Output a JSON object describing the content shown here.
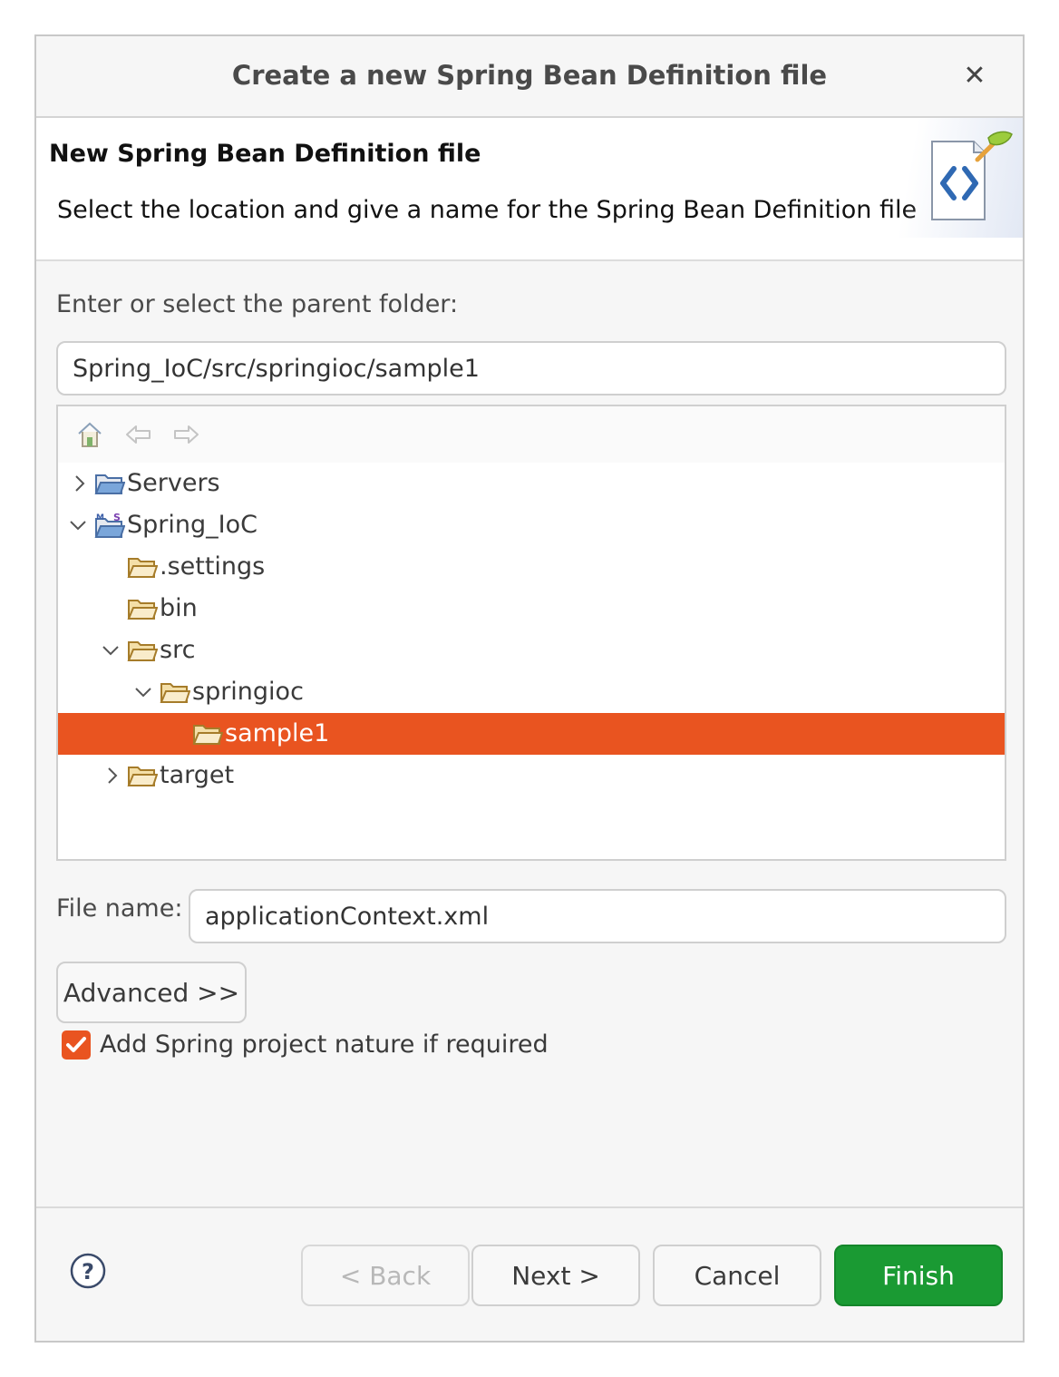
{
  "dialog": {
    "title": "Create a new Spring Bean Definition file",
    "close_icon": "close-icon"
  },
  "header": {
    "title": "New Spring Bean Definition file",
    "description": "Select the location and give a name for the Spring Bean Definition file",
    "graphic_icon": "spring-bean-xml-icon"
  },
  "folder": {
    "label": "Enter or select the parent folder:",
    "value": "Spring_IoC/src/springioc/sample1"
  },
  "tree": {
    "toolbar": [
      "home-icon",
      "back-arrow-icon",
      "forward-arrow-icon"
    ],
    "items": [
      {
        "label": "Servers",
        "expanded": false
      },
      {
        "label": "Spring_IoC",
        "expanded": true
      },
      {
        "label": ".settings"
      },
      {
        "label": "bin"
      },
      {
        "label": "src",
        "expanded": true
      },
      {
        "label": "springioc",
        "expanded": true
      },
      {
        "label": "sample1",
        "selected": true
      },
      {
        "label": "target",
        "expanded": false
      }
    ]
  },
  "file": {
    "label": "File name:",
    "value": "applicationContext.xml"
  },
  "advanced_button": "Advanced >>",
  "checkbox": {
    "label": "Add Spring project nature if required",
    "checked": true
  },
  "footer": {
    "help_icon": "help-icon",
    "back": "< Back",
    "next": "Next >",
    "cancel": "Cancel",
    "finish": "Finish"
  },
  "colors": {
    "selection": "#e95420",
    "primary_button": "#1a9a33",
    "checkbox": "#e95420"
  }
}
